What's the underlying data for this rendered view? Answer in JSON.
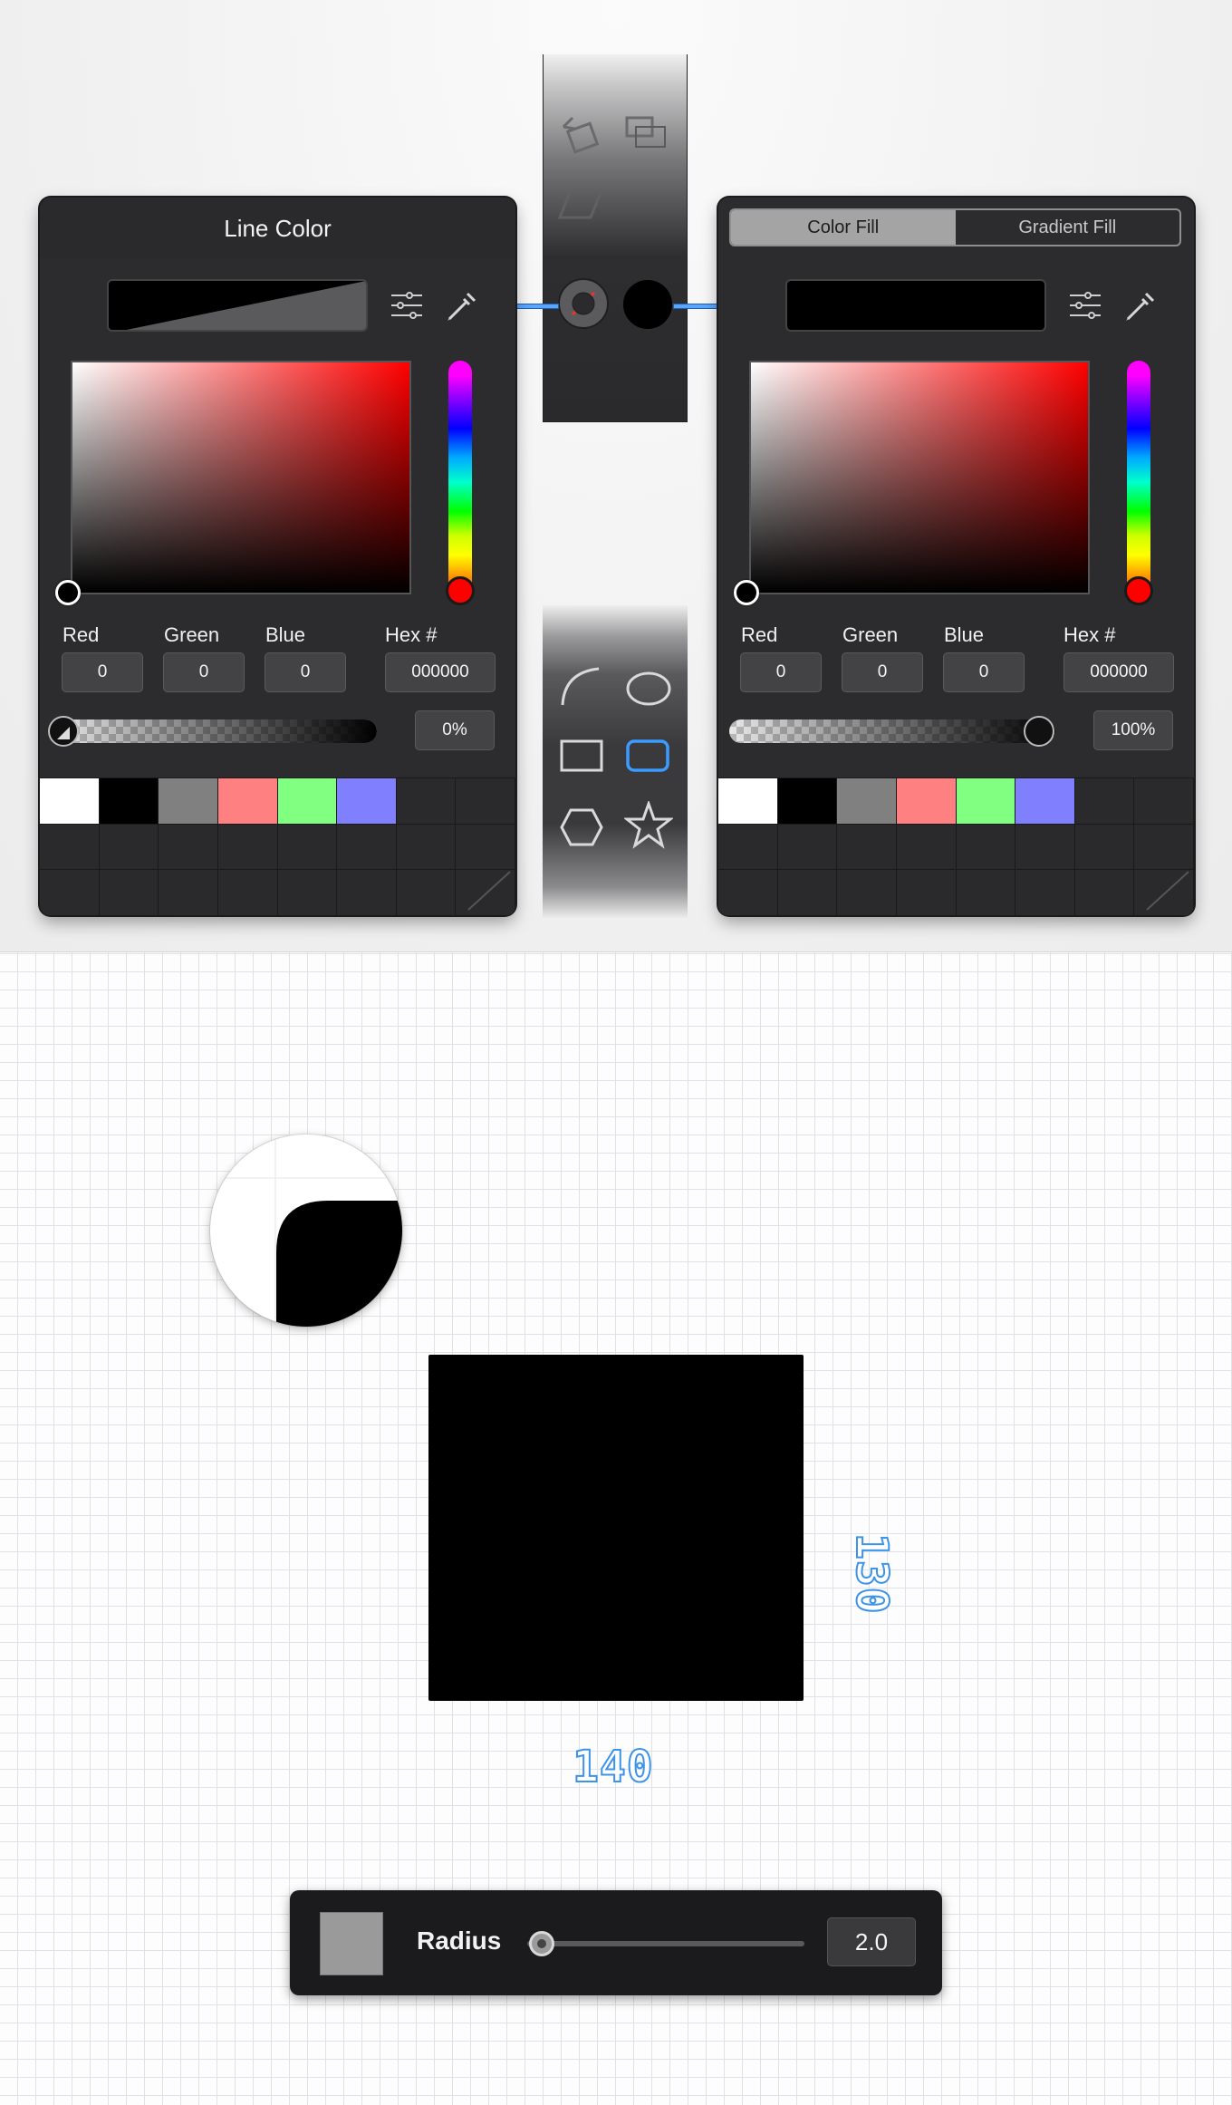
{
  "left_panel": {
    "title": "Line Color",
    "labels": {
      "red": "Red",
      "green": "Green",
      "blue": "Blue",
      "hex": "Hex #"
    },
    "values": {
      "red": "0",
      "green": "0",
      "blue": "0",
      "hex": "000000"
    },
    "opacity": "0%",
    "opacity_fraction": 0
  },
  "right_panel": {
    "tabs": [
      "Color Fill",
      "Gradient Fill"
    ],
    "active_tab": "Color Fill",
    "labels": {
      "red": "Red",
      "green": "Green",
      "blue": "Blue",
      "hex": "Hex #"
    },
    "values": {
      "red": "0",
      "green": "0",
      "blue": "0",
      "hex": "000000"
    },
    "opacity": "100%",
    "opacity_fraction": 1
  },
  "swatches": [
    "#ffffff",
    "#000000",
    "#808080",
    "#ff8080",
    "#80ff80",
    "#8080ff"
  ],
  "tool_strip": {
    "top_icons": [
      "rotate-icon",
      "arrange-icon",
      "skew-icon",
      "stroke-style-icon",
      "fill-style-icon"
    ],
    "bottom_icons": [
      "arc-icon",
      "ellipse-icon",
      "rectangle-icon",
      "rounded-rectangle-icon",
      "polygon-icon",
      "star-icon"
    ],
    "selected_tool": "rounded-rectangle-icon"
  },
  "canvas": {
    "width_label": "140",
    "height_label": "130",
    "shape_color": "#000000"
  },
  "radius_toolbar": {
    "label": "Radius",
    "value": "2.0",
    "swatch_color": "#9a9a9a"
  },
  "colors": {
    "accent": "#58a6ff",
    "panel_bg": "#2c2c2e"
  }
}
